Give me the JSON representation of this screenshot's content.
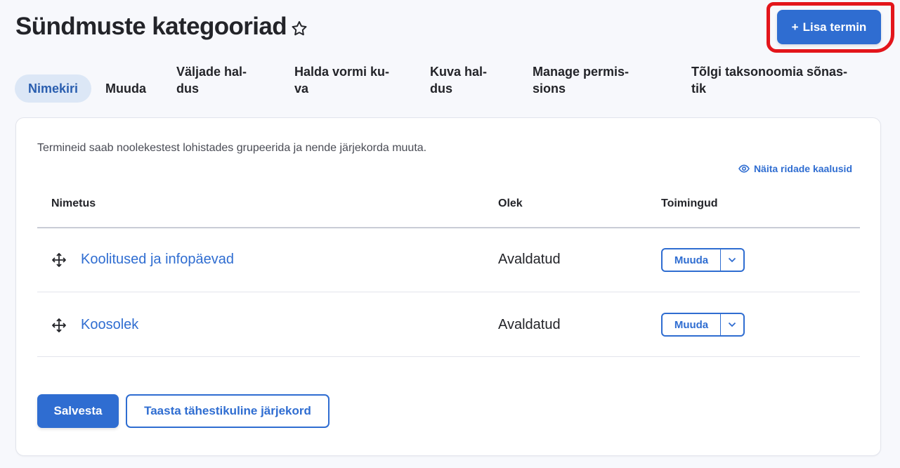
{
  "header": {
    "title": "Sündmuste kategooriad",
    "add_button_label": "Lisa termin",
    "add_button_plus": "+"
  },
  "tabs": [
    {
      "label": "Nimekiri",
      "active": true
    },
    {
      "line1": "Muuda"
    },
    {
      "line1": "Väljade hal-",
      "line2": "dus"
    },
    {
      "line1": "Halda vormi ku-",
      "line2": "va"
    },
    {
      "line1": "Kuva hal-",
      "line2": "dus"
    },
    {
      "line1": "Manage permis-",
      "line2": "sions"
    },
    {
      "line1": "Tõlgi taksonoomia sõnas-",
      "line2": "tik"
    }
  ],
  "content": {
    "help_text": "Termineid saab noolekestest lohistades grupeerida ja nende järjekorda muuta.",
    "show_weights_label": "Näita ridade kaalusid",
    "columns": [
      "Nimetus",
      "Olek",
      "Toimingud"
    ],
    "rows": [
      {
        "name": "Koolitused ja infopäevad",
        "status": "Avaldatud",
        "action": "Muuda"
      },
      {
        "name": "Koosolek",
        "status": "Avaldatud",
        "action": "Muuda"
      }
    ],
    "save_label": "Salvesta",
    "reset_label": "Taasta tähestikuline järjekord"
  },
  "colors": {
    "accent": "#2f6dd1",
    "highlight": "#e3151b",
    "active_tab_bg": "#dce7f6"
  },
  "icons": {
    "favorite": "star-icon",
    "drag": "move-arrows-icon",
    "weights": "eye-icon",
    "dropdown": "chevron-down-icon"
  }
}
